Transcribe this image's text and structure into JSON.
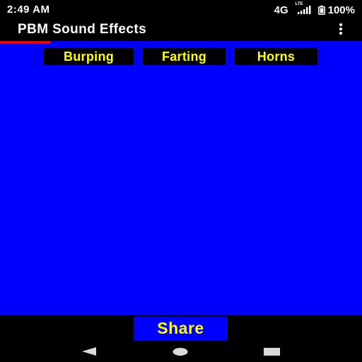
{
  "status_bar": {
    "time": "2:49 AM",
    "network": "4G",
    "network_sub": "LTE",
    "battery": "100%",
    "icons": [
      "signal-icon",
      "battery-icon"
    ]
  },
  "app_bar": {
    "title": "PBM Sound Effects",
    "menu_icon": "overflow-menu-icon"
  },
  "tabs": [
    {
      "label": "Burping",
      "selected": true
    },
    {
      "label": "Farting",
      "selected": false
    },
    {
      "label": "Horns",
      "selected": false
    }
  ],
  "bottom": {
    "share_label": "Share"
  },
  "nav_bar": {
    "icons": [
      "back-icon",
      "home-icon",
      "recents-icon"
    ]
  },
  "colors": {
    "background": "#0000ff",
    "tab_text": "#ffff00",
    "tab_background": "#000000",
    "accent_line": "#e8000b",
    "bars": "#000000"
  }
}
